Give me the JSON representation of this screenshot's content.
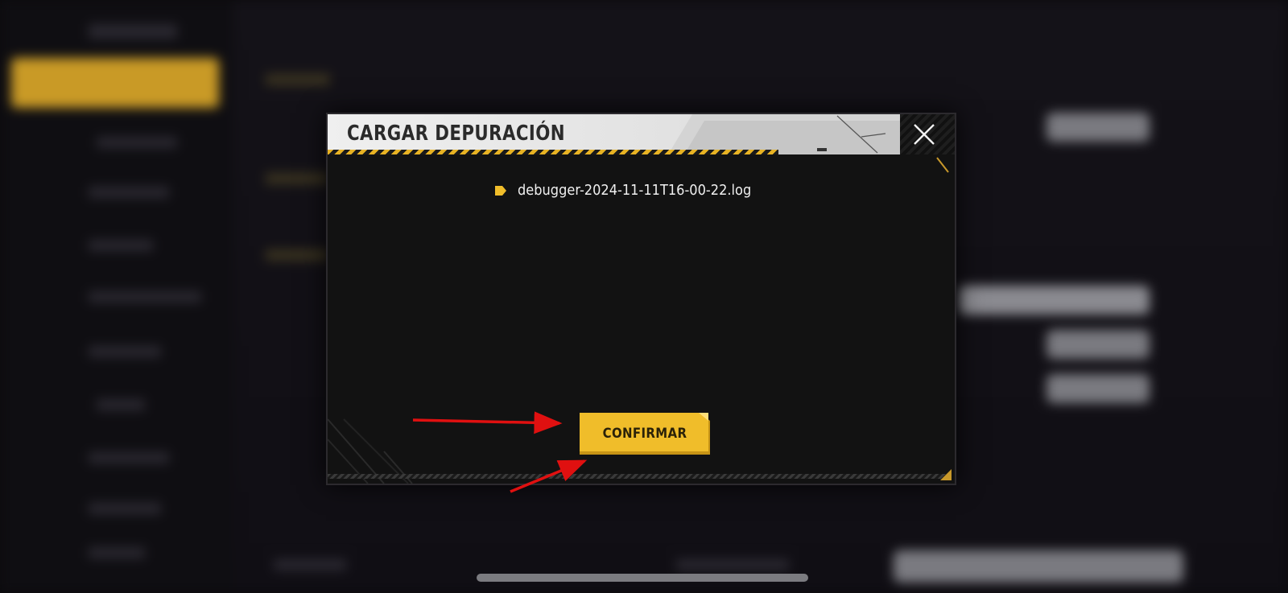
{
  "dialog": {
    "title": "CARGAR DEPURACIÓN",
    "files": [
      "debugger-2024-11-11T16-00-22.log"
    ],
    "confirm_label": "CONFIRMAR"
  },
  "colors": {
    "accent": "#f0bd2a",
    "annotation_arrow": "#e01010",
    "dialog_bg": "#121212",
    "header_bg": "#e8e8e8"
  },
  "icons": {
    "close": "close-icon",
    "file_bullet": "tag-bullet-icon"
  }
}
